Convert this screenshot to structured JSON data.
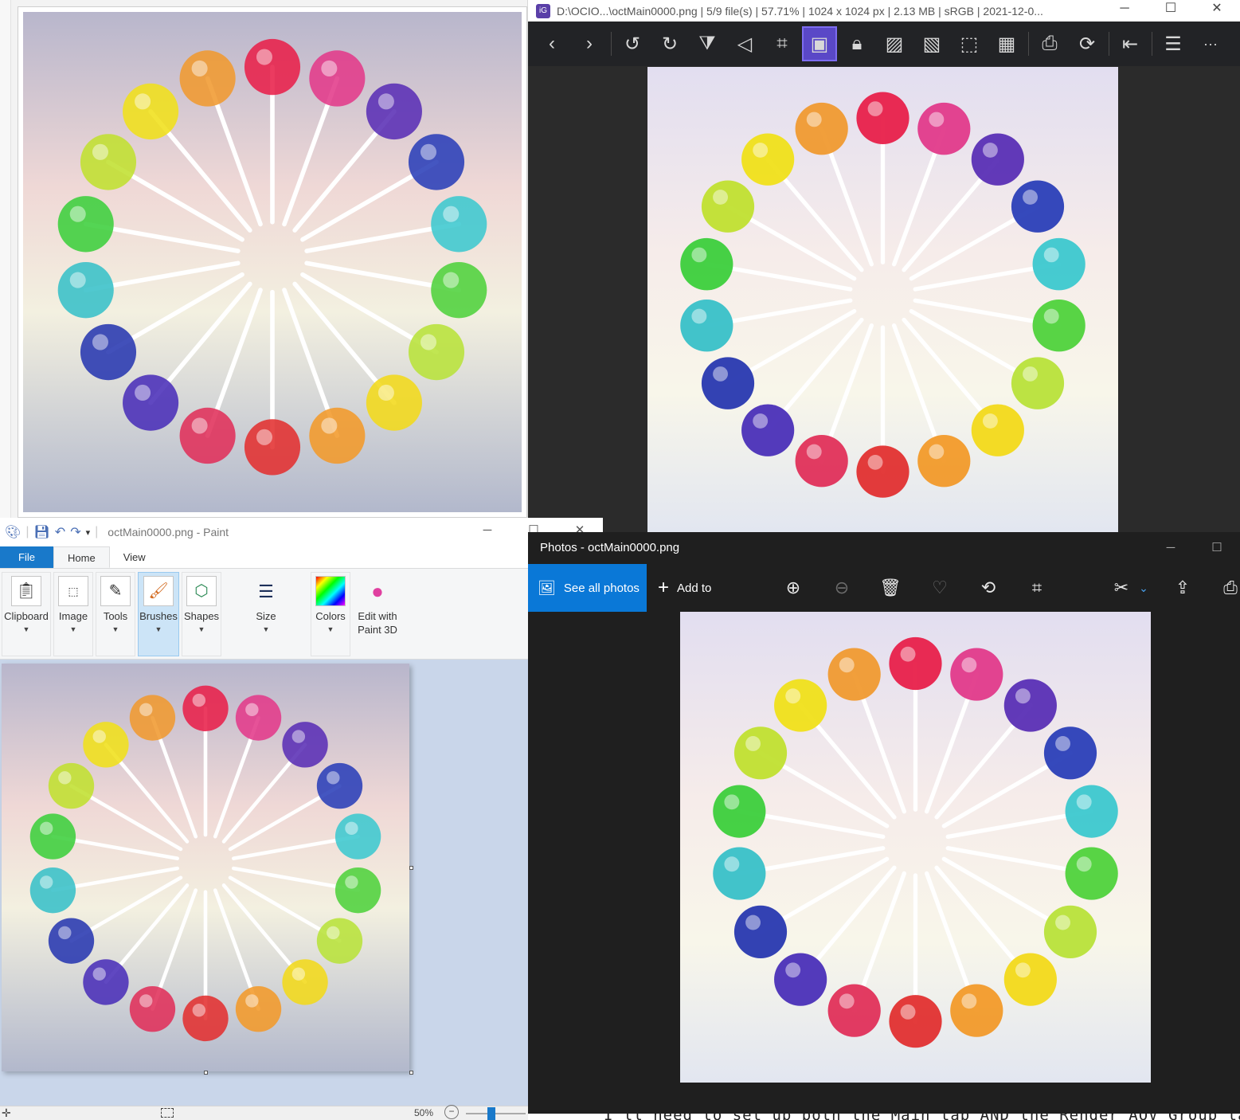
{
  "viewer": {
    "title": "D:\\OCIO...\\octMain0000.png  |  5/9 file(s)  |  57.71%  |  1024 x 1024 px  |  2.13 MB  |  sRGB  |  2021-12-0...",
    "minimize": "─",
    "maximize": "☐",
    "close": "✕",
    "toolbar_icons": [
      "prev-icon",
      "next-icon",
      "rotate-left-icon",
      "rotate-right-icon",
      "flip-horizontal-icon",
      "flip-vertical-icon",
      "crop-icon",
      "fit-image-icon",
      "lock-icon",
      "image-icon-1",
      "image-icon-2",
      "image-icon-3",
      "image-icon-4",
      "print-icon",
      "refresh-icon",
      "compare-icon",
      "menu-icon",
      "more-icon"
    ]
  },
  "paint": {
    "title": "octMain0000.png - Paint",
    "minimize": "─",
    "maximize": "☐",
    "close": "✕",
    "tabs": [
      "File",
      "Home",
      "View"
    ],
    "ribbon": [
      {
        "label": "Clipboard",
        "icon": "clipboard-icon"
      },
      {
        "label": "Image",
        "icon": "image-select-icon"
      },
      {
        "label": "Tools",
        "icon": "tools-icon"
      },
      {
        "label": "Brushes",
        "icon": "brush-icon"
      },
      {
        "label": "Shapes",
        "icon": "shapes-icon"
      },
      {
        "label": "Size",
        "icon": "size-icon"
      },
      {
        "label": "Colors",
        "icon": "colors-icon"
      },
      {
        "label": "Edit with Paint 3D",
        "icon": "paint3d-icon"
      }
    ],
    "zoom": "50%"
  },
  "photos": {
    "title": "Photos - octMain0000.png",
    "see_all": "See all photos",
    "add_to": "Add to",
    "minimize": "─",
    "maximize": "☐"
  },
  "behind_text": "I'll need to set up both the Main tab AND the Render AOV Group tab as you",
  "colors": {
    "accent_blue": "#0a78d7",
    "paint_file_tab": "#1979ca",
    "viewer_active": "#5a48c7"
  }
}
